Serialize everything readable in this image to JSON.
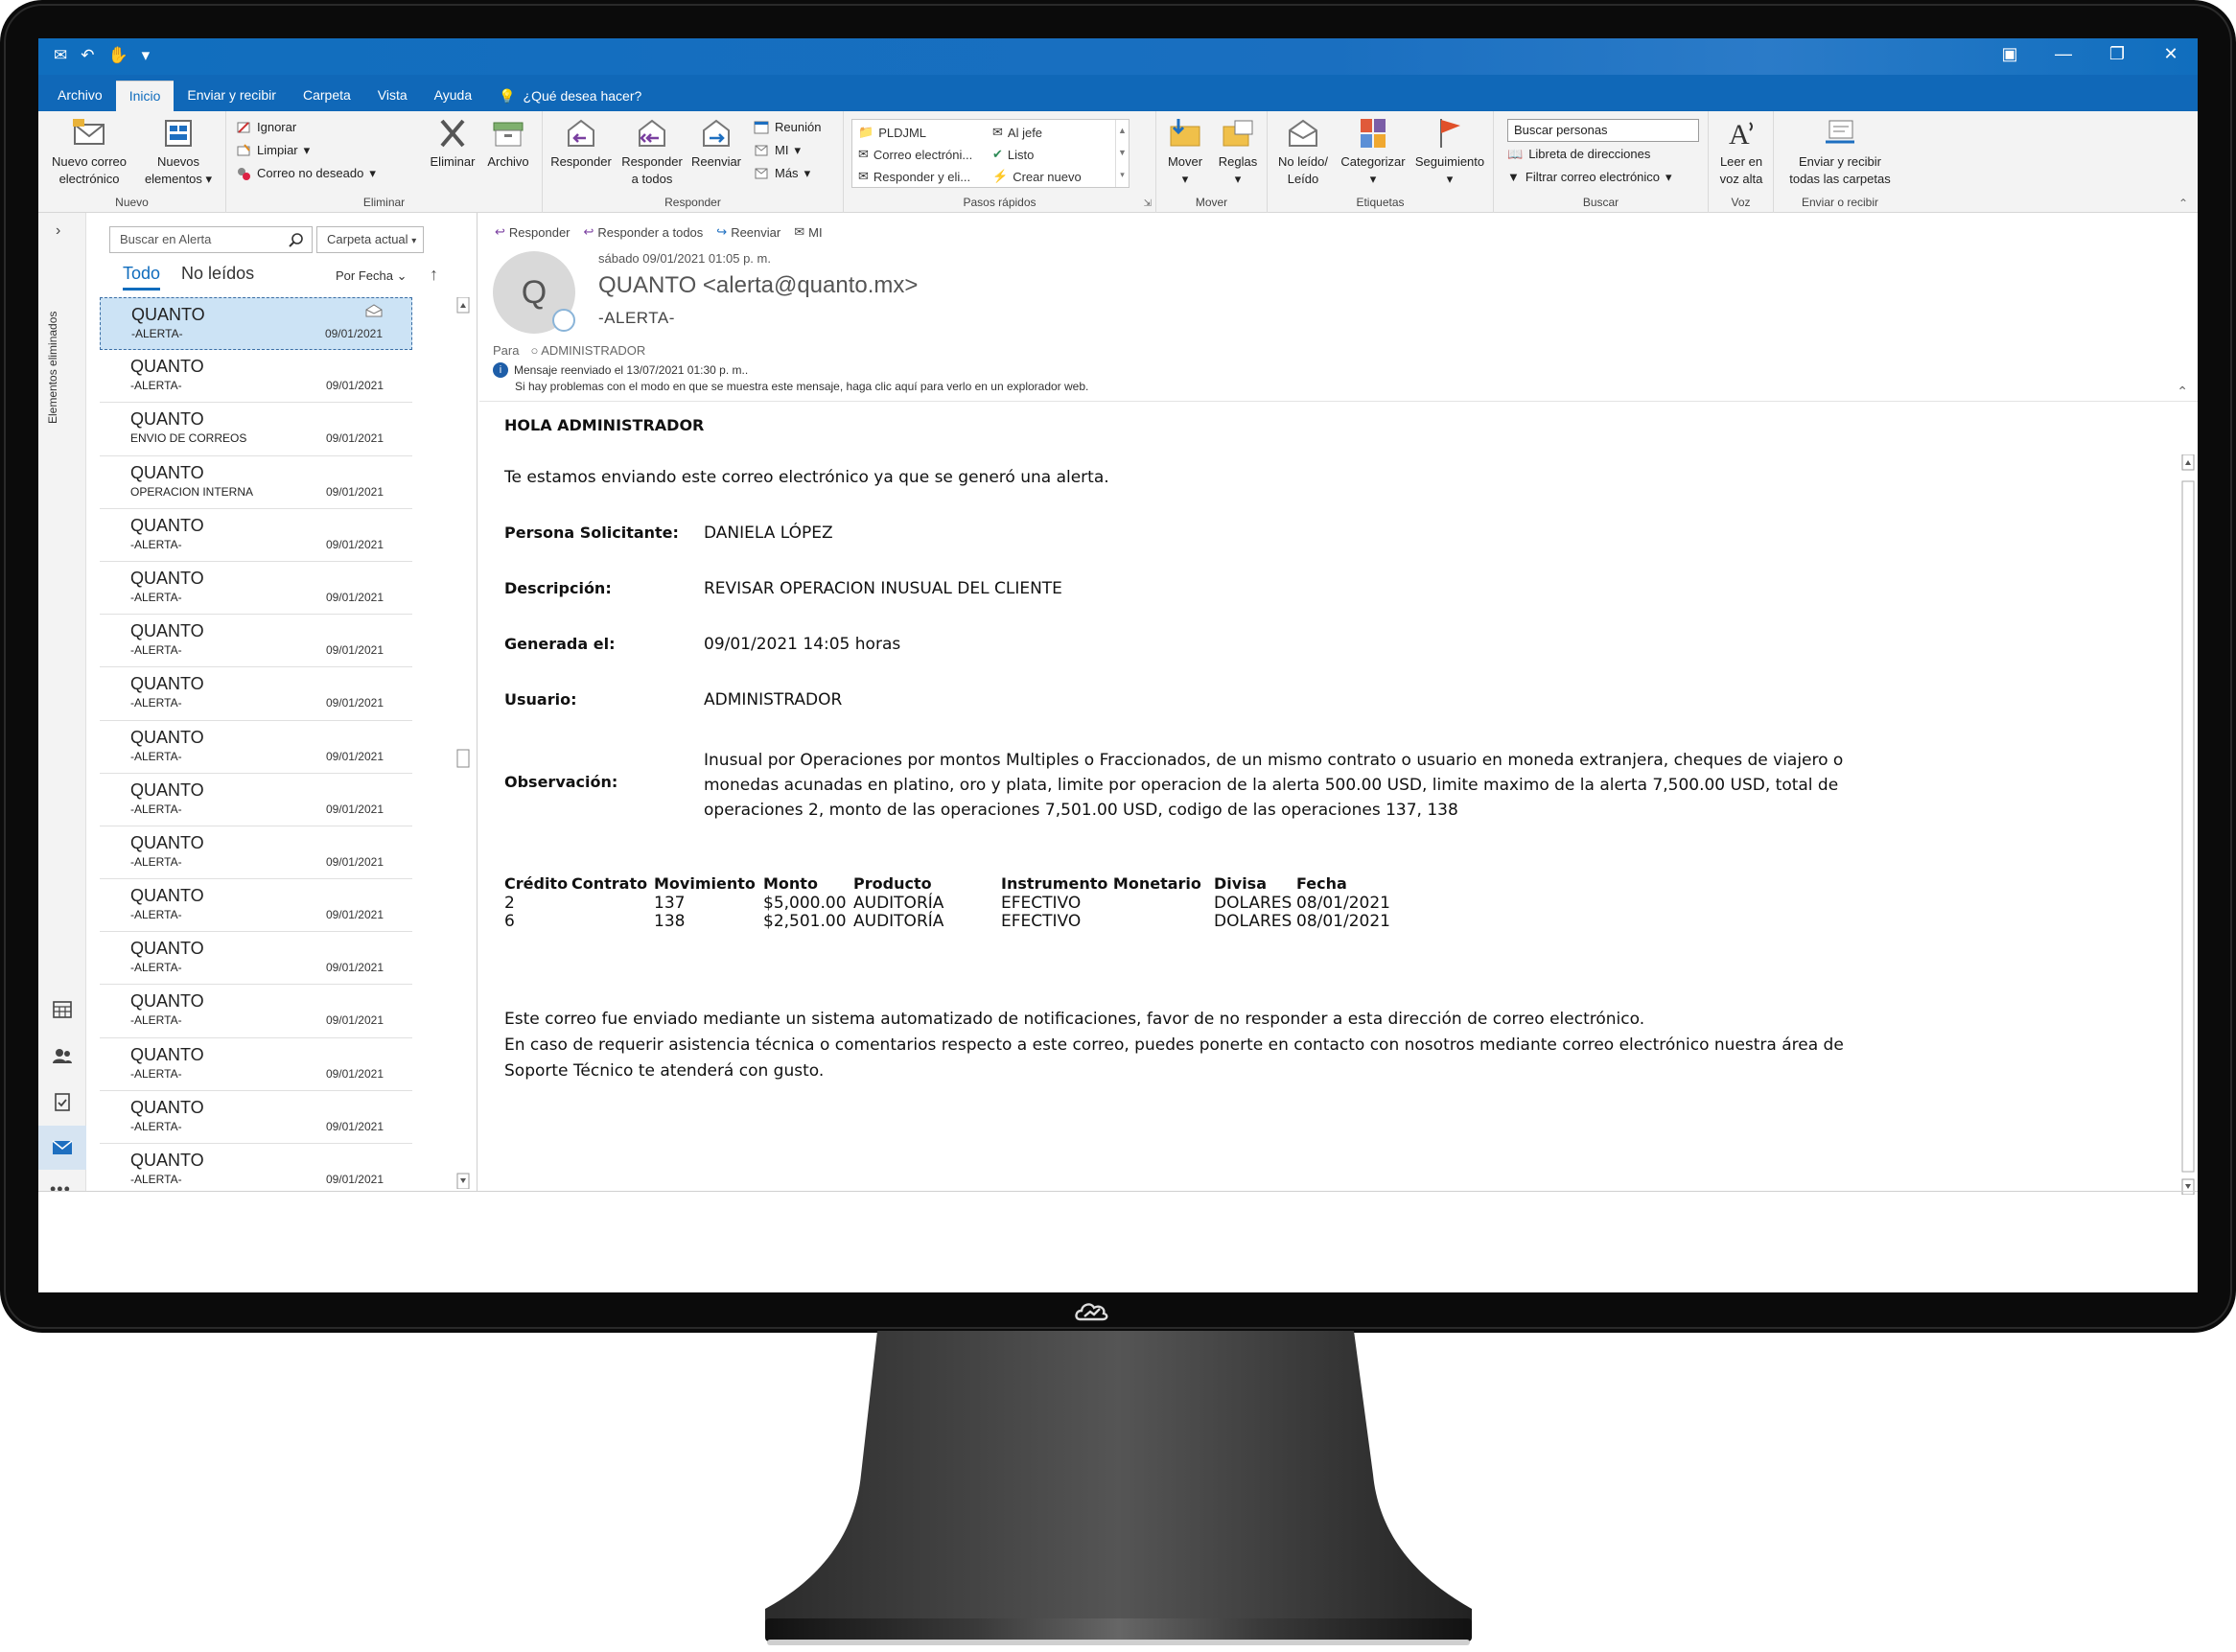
{
  "titlebar": {
    "qat_icons": [
      "send-receive-icon",
      "undo-icon",
      "touch-mode-icon",
      "customize-icon"
    ],
    "window_controls": [
      "ribbon-display-icon",
      "minimize-icon",
      "restore-icon",
      "close-icon"
    ]
  },
  "tabs": [
    "Archivo",
    "Inicio",
    "Enviar y recibir",
    "Carpeta",
    "Vista",
    "Ayuda"
  ],
  "tell_me": "¿Qué desea hacer?",
  "ribbon": {
    "nuevo": {
      "label": "Nuevo",
      "new_email_1": "Nuevo correo",
      "new_email_2": "electrónico",
      "new_items_1": "Nuevos",
      "new_items_2": "elementos"
    },
    "eliminar": {
      "label": "Eliminar",
      "ignore": "Ignorar",
      "clean": "Limpiar",
      "junk": "Correo no deseado",
      "delete": "Eliminar",
      "archive": "Archivo"
    },
    "responder": {
      "label": "Responder",
      "reply": "Responder",
      "reply_all_1": "Responder",
      "reply_all_2": "a todos",
      "forward": "Reenviar",
      "meeting": "Reunión",
      "im": "MI",
      "more": "Más"
    },
    "pasos": {
      "label": "Pasos rápidos",
      "s1": "PLDJML",
      "s2": "Correo electróni...",
      "s3": "Responder y eli...",
      "s4": "Al jefe",
      "s5": "Listo",
      "s6": "Crear nuevo"
    },
    "mover": {
      "label": "Mover",
      "move": "Mover",
      "rules": "Reglas"
    },
    "etiquetas": {
      "label": "Etiquetas",
      "unread_1": "No leído/",
      "unread_2": "Leído",
      "categorize": "Categorizar",
      "followup": "Seguimiento"
    },
    "buscar": {
      "label": "Buscar",
      "people_search": "Buscar personas",
      "address_book": "Libreta de direcciones",
      "filter": "Filtrar correo electrónico"
    },
    "voz": {
      "label": "Voz",
      "read_1": "Leer en",
      "read_2": "voz alta"
    },
    "enviar": {
      "label": "Enviar o recibir",
      "sr_1": "Enviar y recibir",
      "sr_2": "todas las carpetas"
    }
  },
  "rail": {
    "folder_label": "Elementos eliminados"
  },
  "list": {
    "search_placeholder": "Buscar en Alerta",
    "scope": "Carpeta actual",
    "filter_all": "Todo",
    "filter_unread": "No leídos",
    "sort": "Por Fecha",
    "rows": [
      {
        "from": "QUANTO",
        "subject": "-ALERTA-",
        "date": "09/01/2021"
      },
      {
        "from": "QUANTO",
        "subject": "-ALERTA-",
        "date": "09/01/2021"
      },
      {
        "from": "QUANTO",
        "subject": "ENVIO DE CORREOS",
        "date": "09/01/2021"
      },
      {
        "from": "QUANTO",
        "subject": "OPERACION INTERNA",
        "date": "09/01/2021"
      },
      {
        "from": "QUANTO",
        "subject": "-ALERTA-",
        "date": "09/01/2021"
      },
      {
        "from": "QUANTO",
        "subject": "-ALERTA-",
        "date": "09/01/2021"
      },
      {
        "from": "QUANTO",
        "subject": "-ALERTA-",
        "date": "09/01/2021"
      },
      {
        "from": "QUANTO",
        "subject": "-ALERTA-",
        "date": "09/01/2021"
      },
      {
        "from": "QUANTO",
        "subject": "-ALERTA-",
        "date": "09/01/2021"
      },
      {
        "from": "QUANTO",
        "subject": "-ALERTA-",
        "date": "09/01/2021"
      },
      {
        "from": "QUANTO",
        "subject": "-ALERTA-",
        "date": "09/01/2021"
      },
      {
        "from": "QUANTO",
        "subject": "-ALERTA-",
        "date": "09/01/2021"
      },
      {
        "from": "QUANTO",
        "subject": "-ALERTA-",
        "date": "09/01/2021"
      },
      {
        "from": "QUANTO",
        "subject": "-ALERTA-",
        "date": "09/01/2021"
      },
      {
        "from": "QUANTO",
        "subject": "-ALERTA-",
        "date": "09/01/2021"
      },
      {
        "from": "QUANTO",
        "subject": "-ALERTA-",
        "date": "09/01/2021"
      },
      {
        "from": "QUANTO",
        "subject": "-ALERTA-",
        "date": "09/01/2021"
      }
    ]
  },
  "reader": {
    "actions": {
      "reply": "Responder",
      "reply_all": "Responder a todos",
      "forward": "Reenviar",
      "im": "MI"
    },
    "avatar_letter": "Q",
    "when": "sábado 09/01/2021 01:05 p. m.",
    "sender": "QUANTO <alerta@quanto.mx>",
    "subject": "-ALERTA-",
    "to_label": "Para",
    "to": "ADMINISTRADOR",
    "info1": "Mensaje reenviado el 13/07/2021 01:30 p. m..",
    "info2": "Si hay problemas con el modo en que se muestra este mensaje, haga clic aquí para verlo en un explorador web."
  },
  "email": {
    "greeting": "HOLA ADMINISTRADOR",
    "intro": "Te estamos enviando este correo electrónico ya que se generó una alerta.",
    "solicitante_label": "Persona Solicitante:",
    "solicitante": "DANIELA LÓPEZ",
    "descripcion_label": "Descripción:",
    "descripcion": "REVISAR OPERACION INUSUAL DEL CLIENTE",
    "generada_label": "Generada el:",
    "generada": "09/01/2021 14:05 horas",
    "usuario_label": "Usuario:",
    "usuario": "ADMINISTRADOR",
    "observacion_label": "Observación:",
    "observacion": "Inusual por Operaciones por montos Multiples o Fraccionados, de un mismo contrato o usuario en moneda extranjera, cheques de viajero o monedas acunadas en platino, oro y plata, limite por operacion de la alerta 500.00 USD, limite maximo de la alerta 7,500.00 USD, total de operaciones 2, monto de las operaciones 7,501.00 USD, codigo de las operaciones 137, 138",
    "table": {
      "headers": [
        "Crédito",
        "Contrato",
        "Movimiento",
        "Monto",
        "Producto",
        "Instrumento Monetario",
        "Divisa",
        "Fecha"
      ],
      "rows": [
        [
          "2",
          "",
          "137",
          "$5,000.00",
          "AUDITORÍA",
          "EFECTIVO",
          "DOLARES",
          "08/01/2021"
        ],
        [
          "6",
          "",
          "138",
          "$2,501.00",
          "AUDITORÍA",
          "EFECTIVO",
          "DOLARES",
          "08/01/2021"
        ]
      ]
    },
    "footer1": "Este correo fue enviado mediante un sistema automatizado de notificaciones, favor de no responder a esta dirección de correo electrónico.",
    "footer2": "En caso de requerir asistencia técnica o comentarios respecto a este correo, puedes ponerte en contacto con nosotros mediante correo electrónico nuestra área de Soporte Técnico te atenderá con gusto."
  },
  "colors": {
    "accent": "#0f6cbd",
    "selected_row": "#cce3f5",
    "bezel": "#0b0b0b"
  }
}
